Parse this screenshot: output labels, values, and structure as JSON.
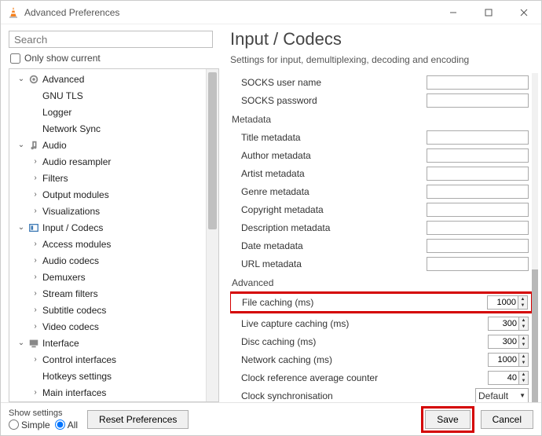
{
  "window": {
    "title": "Advanced Preferences"
  },
  "search": {
    "placeholder": "Search"
  },
  "only_show_current": "Only show current",
  "tree": {
    "advanced": "Advanced",
    "gnu_tls": "GNU TLS",
    "logger": "Logger",
    "network_sync": "Network Sync",
    "audio": "Audio",
    "audio_resampler": "Audio resampler",
    "filters": "Filters",
    "output_modules": "Output modules",
    "visualizations": "Visualizations",
    "input_codecs": "Input / Codecs",
    "access_modules": "Access modules",
    "audio_codecs": "Audio codecs",
    "demuxers": "Demuxers",
    "stream_filters": "Stream filters",
    "subtitle_codecs": "Subtitle codecs",
    "video_codecs": "Video codecs",
    "interface": "Interface",
    "control_interfaces": "Control interfaces",
    "hotkeys_settings": "Hotkeys settings",
    "main_interfaces": "Main interfaces"
  },
  "panel": {
    "heading": "Input / Codecs",
    "subhead": "Settings for input, demultiplexing, decoding and encoding",
    "socks_user": "SOCKS user name",
    "socks_pass": "SOCKS password",
    "section_metadata": "Metadata",
    "title_meta": "Title metadata",
    "author_meta": "Author metadata",
    "artist_meta": "Artist metadata",
    "genre_meta": "Genre metadata",
    "copyright_meta": "Copyright metadata",
    "description_meta": "Description metadata",
    "date_meta": "Date metadata",
    "url_meta": "URL metadata",
    "section_advanced": "Advanced",
    "file_caching": "File caching (ms)",
    "file_caching_val": "1000",
    "live_caching": "Live capture caching (ms)",
    "live_caching_val": "300",
    "disc_caching": "Disc caching (ms)",
    "disc_caching_val": "300",
    "network_caching": "Network caching (ms)",
    "network_caching_val": "1000",
    "clock_ref": "Clock reference average counter",
    "clock_ref_val": "40",
    "clock_sync": "Clock synchronisation",
    "clock_sync_val": "Default"
  },
  "footer": {
    "show_settings": "Show settings",
    "simple": "Simple",
    "all": "All",
    "reset": "Reset Preferences",
    "save": "Save",
    "cancel": "Cancel"
  }
}
